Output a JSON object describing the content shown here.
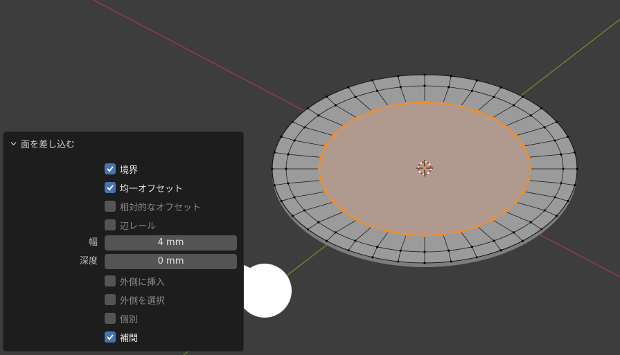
{
  "operator_panel": {
    "title": "面を差し込む",
    "options": [
      {
        "label": "境界",
        "checked": true,
        "enabled": true
      },
      {
        "label": "均一オフセット",
        "checked": true,
        "enabled": true
      },
      {
        "label": "相対的なオフセット",
        "checked": false,
        "enabled": false
      },
      {
        "label": "辺レール",
        "checked": false,
        "enabled": false
      }
    ],
    "fields": [
      {
        "label": "幅",
        "value": "4 mm"
      },
      {
        "label": "深度",
        "value": "0 mm"
      }
    ],
    "options2": [
      {
        "label": "外側に挿入",
        "checked": false,
        "enabled": false
      },
      {
        "label": "外側を選択",
        "checked": false,
        "enabled": false
      },
      {
        "label": "個別",
        "checked": false,
        "enabled": false
      },
      {
        "label": "補間",
        "checked": true,
        "enabled": true
      }
    ]
  },
  "colors": {
    "viewport_bg": "#3d3d3d",
    "panel_bg": "#1d1d1d",
    "checkbox_on": "#4772b3",
    "x_axis": "#9e3b4a",
    "y_axis": "#6b8f2a",
    "selection": "#ff8c1a",
    "selected_face": "#b09a8f",
    "mesh_face": "#9b9b9b"
  }
}
